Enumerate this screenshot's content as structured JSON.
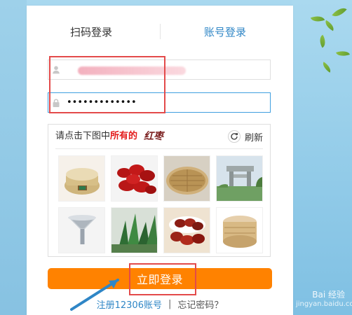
{
  "tabs": {
    "qr": "扫码登录",
    "account": "账号登录"
  },
  "fields": {
    "username": {
      "value": "",
      "placeholder": ""
    },
    "password": {
      "value": "•••••••••••••",
      "placeholder": ""
    }
  },
  "captcha": {
    "instruction_prefix": "请点击下图中",
    "instruction_strong": "所有的",
    "target": "红枣",
    "refresh_label": "刷新"
  },
  "actions": {
    "login": "立即登录",
    "register": "注册12306账号",
    "separator": "|",
    "forgot": "忘记密码？"
  },
  "watermark": {
    "brand": "Bai 经验",
    "domain": "jingyan.baidu.com"
  },
  "icons": {
    "user": "user-icon",
    "lock": "lock-icon",
    "refresh": "refresh-icon"
  },
  "colors": {
    "primary_blue": "#2f86c6",
    "orange": "#ff8200",
    "alert_red": "#e31b1b"
  }
}
